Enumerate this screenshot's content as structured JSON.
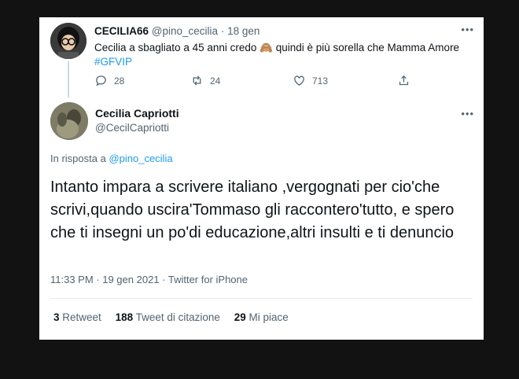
{
  "tweet1": {
    "display_name": "CECILIA66",
    "handle": "@pino_cecilia",
    "separator": "·",
    "date": "18 gen",
    "text_part1": "Cecilia a sbagliato a 45 anni credo ",
    "emoji": "🙈",
    "text_part2": " quindi è più sorella che Mamma Amore ",
    "hashtag": "#GFVIP",
    "replies": "28",
    "retweets": "24",
    "likes": "713",
    "more": "•••"
  },
  "tweet2": {
    "display_name": "Cecilia Capriotti",
    "handle": "@CecilCapriotti",
    "more": "•••",
    "reply_prefix": "In risposta a ",
    "reply_to": "@pino_cecilia",
    "body": "Intanto impara a scrivere italiano ,vergognati per cio'che scrivi,quando uscira'Tommaso gli raccontero'tutto, e spero che ti insegni un po'di educazione,altri insulti e ti denuncio",
    "timestamp": "11:33 PM · 19 gen 2021 · Twitter for iPhone",
    "retweets_count": "3",
    "retweets_label": "Retweet",
    "quotes_count": "188",
    "quotes_label": "Tweet di citazione",
    "likes_count": "29",
    "likes_label": "Mi piace"
  },
  "icons": [
    "reply-icon",
    "retweet-icon",
    "like-icon",
    "share-icon",
    "more-icon"
  ]
}
